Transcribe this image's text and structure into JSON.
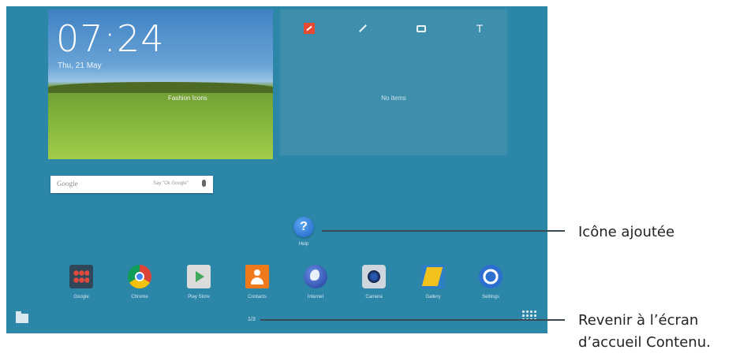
{
  "clock_widget": {
    "time": "07:24",
    "date": "Thu, 21 May",
    "location": "Fashion Icons"
  },
  "notes_widget": {
    "tools": [
      "scrapbook-icon",
      "pen-icon",
      "camera-crop-icon",
      "text-icon"
    ],
    "text_tool_glyph": "T",
    "empty_text": "No items"
  },
  "search": {
    "logo": "Google",
    "hint": "Say \"Ok Google\""
  },
  "help_app": {
    "label": "Help"
  },
  "dock": [
    {
      "label": "Google",
      "icon": "google-folder-icon"
    },
    {
      "label": "Chrome",
      "icon": "chrome-icon"
    },
    {
      "label": "Play Store",
      "icon": "play-store-icon"
    },
    {
      "label": "Contacts",
      "icon": "contacts-icon"
    },
    {
      "label": "Internet",
      "icon": "internet-icon"
    },
    {
      "label": "Camera",
      "icon": "camera-icon"
    },
    {
      "label": "Gallery",
      "icon": "gallery-icon"
    },
    {
      "label": "Settings",
      "icon": "settings-icon"
    }
  ],
  "page_indicator": "1/3",
  "callouts": {
    "added_icon": "Icône ajoutée",
    "return_line1": "Revenir à l’écran",
    "return_line2": "d’accueil Contenu."
  },
  "colors": {
    "wallpaper": "#2b86a7",
    "widget_panel": "#3d8fab"
  }
}
